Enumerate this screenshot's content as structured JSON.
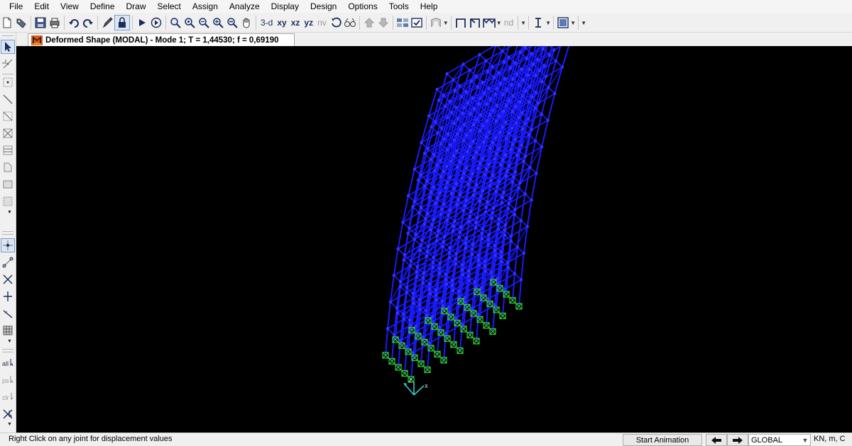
{
  "menu": [
    "File",
    "Edit",
    "View",
    "Define",
    "Draw",
    "Select",
    "Assign",
    "Analyze",
    "Display",
    "Design",
    "Options",
    "Tools",
    "Help"
  ],
  "toolbar": {
    "view_3d": "3-d",
    "view_xy": "xy",
    "view_xz": "xz",
    "view_yz": "yz",
    "view_nv": "nv",
    "node_label": "nd"
  },
  "window": {
    "tab_title": "Deformed Shape (MODAL) - Mode 1; T = 1,44530;  f = 0,69190"
  },
  "axes": {
    "z": "Z",
    "x": "X"
  },
  "status": {
    "message": "Right Click on any joint for displacement values",
    "start_animation": "Start Animation",
    "coordinate_system": "GLOBAL",
    "units": "KN, m, C"
  },
  "colors": {
    "frame": "#1a1aff",
    "support": "#33cc33",
    "axis": "#33cccc",
    "background": "#000000"
  }
}
